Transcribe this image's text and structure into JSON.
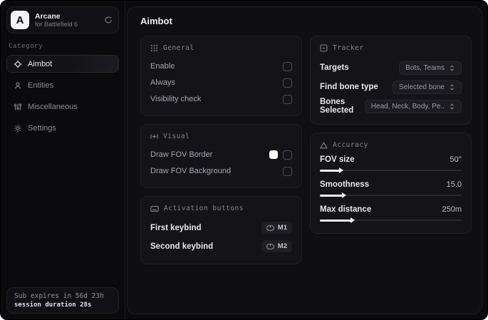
{
  "sidebar": {
    "brand": {
      "initial": "A",
      "name": "Arcane",
      "subtitle": "for Battlefield 6"
    },
    "category_label": "Category",
    "items": [
      {
        "icon": "crosshair-icon",
        "label": "Aimbot",
        "selected": true
      },
      {
        "icon": "entities-icon",
        "label": "Entities",
        "selected": false
      },
      {
        "icon": "sliders-icon",
        "label": "Miscellaneous",
        "selected": false
      },
      {
        "icon": "gear-icon",
        "label": "Settings",
        "selected": false
      }
    ],
    "footer": {
      "line1": "Sub expires in 56d 23h",
      "line2": "session duration 28s"
    }
  },
  "main": {
    "title": "Aimbot",
    "general": {
      "title": "General",
      "rows": [
        {
          "label": "Enable",
          "checked": false
        },
        {
          "label": "Always",
          "checked": false
        },
        {
          "label": "Visibility check",
          "checked": false
        }
      ]
    },
    "visual": {
      "title": "Visual",
      "rows": [
        {
          "label": "Draw FOV Border",
          "swatch": "#ffffff",
          "checked": false
        },
        {
          "label": "Draw FOV Background",
          "checked": false
        }
      ]
    },
    "activation": {
      "title": "Activation buttons",
      "rows": [
        {
          "label": "First keybind",
          "key": "M1"
        },
        {
          "label": "Second keybind",
          "key": "M2"
        }
      ]
    },
    "tracker": {
      "title": "Tracker",
      "rows": [
        {
          "label": "Targets",
          "value": "Bots, Teams"
        },
        {
          "label": "Find bone type",
          "value": "Selected bone"
        },
        {
          "label": "Bones Selected",
          "value": "Head, Neck, Body, Pe.."
        }
      ]
    },
    "accuracy": {
      "title": "Accuracy",
      "rows": [
        {
          "label": "FOV size",
          "value": "50°",
          "fill_pct": 14
        },
        {
          "label": "Smoothness",
          "value": "15.0",
          "fill_pct": 16
        },
        {
          "label": "Max distance",
          "value": "250m",
          "fill_pct": 22
        }
      ]
    }
  },
  "colors": {
    "window_bg": "#0b0b0d",
    "card_bg": "#141418",
    "accent_fill": "#f2f2f4",
    "swatch_white": "#ffffff"
  }
}
